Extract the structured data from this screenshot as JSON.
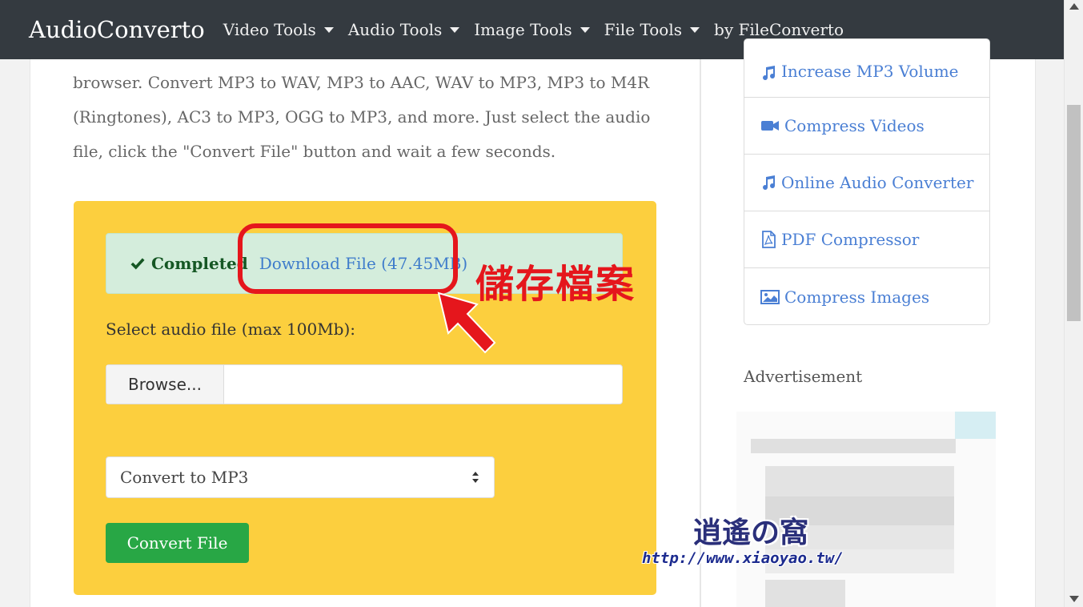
{
  "navbar": {
    "brand": "AudioConverto",
    "items": [
      {
        "label": "Video Tools",
        "dropdown": true
      },
      {
        "label": "Audio Tools",
        "dropdown": true
      },
      {
        "label": "Image Tools",
        "dropdown": true
      },
      {
        "label": "File Tools",
        "dropdown": true
      },
      {
        "label": "by FileConverto",
        "dropdown": false
      }
    ]
  },
  "intro": {
    "text": "browser. Convert MP3 to WAV, MP3 to AAC, WAV to MP3, MP3 to M4R (Ringtones), AC3 to MP3, OGG to MP3, and more. Just select the audio file, click the \"Convert File\" button and wait a few seconds."
  },
  "converter": {
    "status_label": "Completed",
    "download_label": "Download File (47.45MB)",
    "select_label": "Select audio file (max 100Mb):",
    "browse_label": "Browse...",
    "file_value": "",
    "format_value": "Convert to MP3",
    "convert_label": "Convert File",
    "panel_color": "#fccf3e",
    "alert_color": "#d4eddc",
    "button_color": "#28a745"
  },
  "annotation": {
    "text": "儲存檔案",
    "color": "#e5161c"
  },
  "sidebar": {
    "links": [
      {
        "label": "Increase MP3 Volume",
        "icon": "music-icon"
      },
      {
        "label": "Compress Videos",
        "icon": "video-camera-icon"
      },
      {
        "label": "Online Audio Converter",
        "icon": "music-icon"
      },
      {
        "label": "PDF Compressor",
        "icon": "pdf-file-icon"
      },
      {
        "label": "Compress Images",
        "icon": "image-icon"
      }
    ],
    "advertisement_label": "Advertisement",
    "link_color": "#4a7fd4"
  },
  "watermark": {
    "title": "逍遙の窩",
    "url": "http://www.xiaoyao.tw/"
  }
}
